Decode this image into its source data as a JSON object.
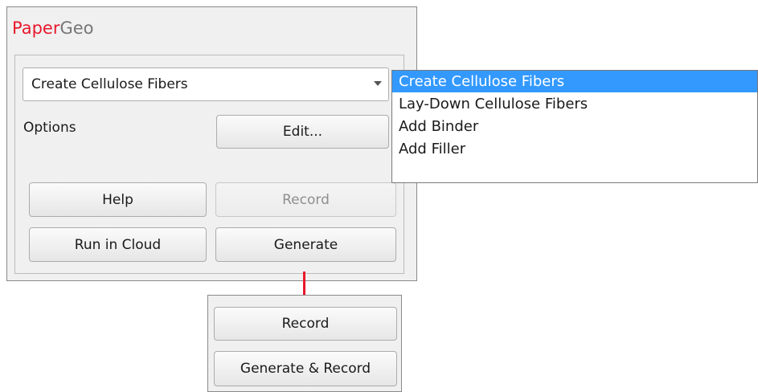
{
  "app": {
    "brand_part1": "Paper",
    "brand_part2": "Geo",
    "brand_color": "#e8192c",
    "brand_secondary_color": "#767676"
  },
  "combo": {
    "selected": "Create Cellulose Fibers"
  },
  "options": {
    "label": "Options",
    "edit_button": "Edit..."
  },
  "buttons": {
    "help": "Help",
    "record": "Record",
    "run_in_cloud": "Run in Cloud",
    "generate": "Generate"
  },
  "dropdown": {
    "items": [
      "Create Cellulose Fibers",
      "Lay-Down Cellulose Fibers",
      "Add Binder",
      "Add Filler"
    ],
    "highlight_color": "#3399ff"
  },
  "record_panel": {
    "record": "Record",
    "generate_and_record": "Generate & Record"
  },
  "annotation": {
    "arrow_color": "#e8192c"
  }
}
